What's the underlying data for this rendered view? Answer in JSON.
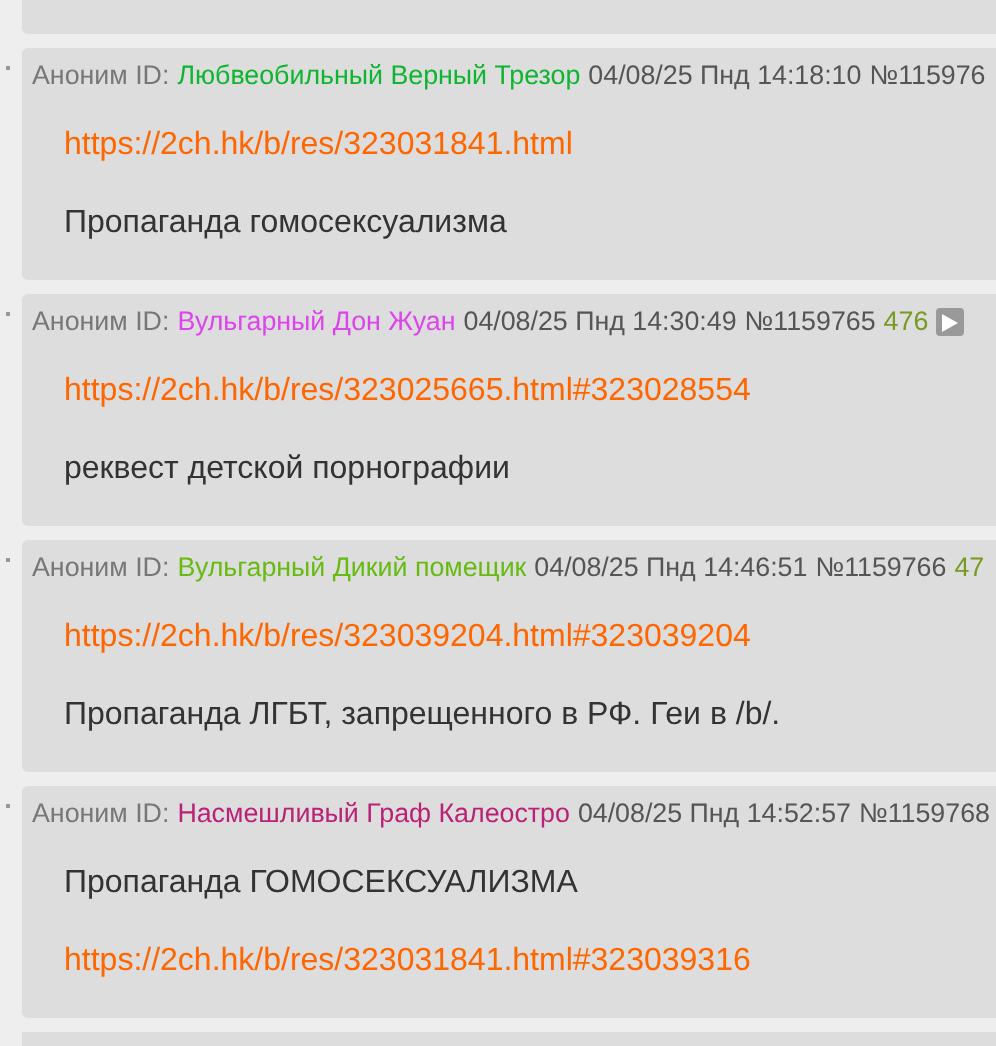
{
  "posts": [
    {
      "author": "Аноним ID:",
      "name": "Любвеобильный Верный Трезор",
      "color": "#0fb530",
      "datetime": "04/08/25 Пнд 14:18:10",
      "number": "№115976",
      "play_button": false,
      "body": [
        {
          "kind": "link",
          "text": "https://2ch.hk/b/res/323031841.html"
        },
        {
          "kind": "text",
          "text": "Пропаганда гомосексуализма"
        }
      ]
    },
    {
      "author": "Аноним ID:",
      "name": "Вульгарный Дон Жуан",
      "color": "#dd44ee",
      "datetime": "04/08/25 Пнд 14:30:49",
      "number": "№1159765",
      "replies": "476",
      "play_button": true,
      "body": [
        {
          "kind": "link",
          "text": "https://2ch.hk/b/res/323025665.html#323028554"
        },
        {
          "kind": "text",
          "text": "реквест детской порнографии"
        }
      ]
    },
    {
      "author": "Аноним ID:",
      "name": "Вульгарный Дикий помещик",
      "color": "#66bb11",
      "datetime": "04/08/25 Пнд 14:46:51",
      "number": "№1159766",
      "replies": "47",
      "play_button": false,
      "body": [
        {
          "kind": "link",
          "text": "https://2ch.hk/b/res/323039204.html#323039204"
        },
        {
          "kind": "text",
          "text": "Пропаганда ЛГБТ, запрещенного в РФ. Геи в /b/."
        }
      ]
    },
    {
      "author": "Аноним ID:",
      "name": "Насмешливый Граф Калеостро",
      "color": "#bb2277",
      "datetime": "04/08/25 Пнд 14:52:57",
      "number": "№1159768",
      "play_button": false,
      "body": [
        {
          "kind": "text",
          "text": "Пропаганда ГОМОСЕКСУАЛИЗМА"
        },
        {
          "kind": "link",
          "text": "https://2ch.hk/b/res/323031841.html#323039316"
        }
      ]
    }
  ]
}
